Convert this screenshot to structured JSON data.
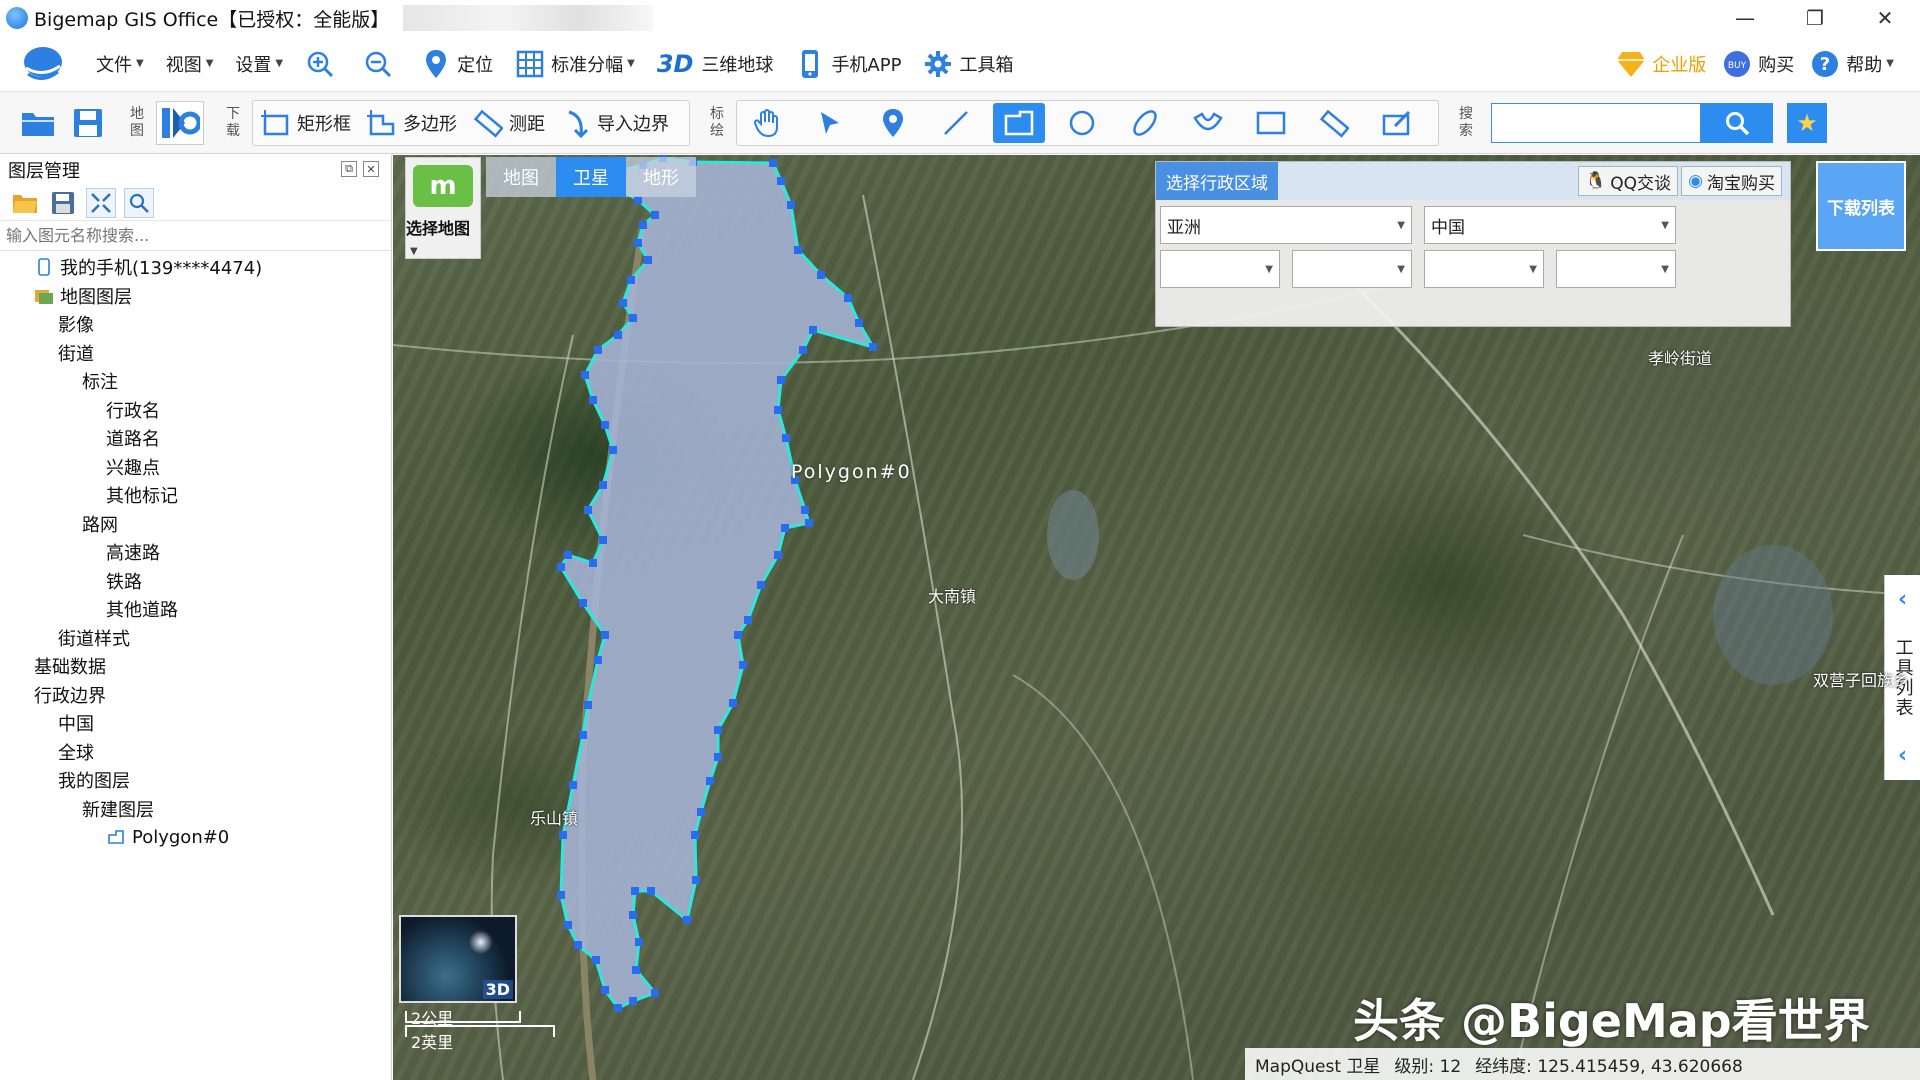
{
  "window": {
    "title": "Bigemap GIS Office【已授权：全能版】",
    "controls": [
      "—",
      "❐",
      "✕"
    ]
  },
  "menu": {
    "file": "文件",
    "view": "视图",
    "settings": "设置",
    "locate": "定位",
    "grid": "标准分幅",
    "globe_3d_prefix": "3D",
    "globe_3d": "三维地球",
    "mobile_app": "手机APP",
    "toolbox": "工具箱",
    "enterprise": "企业版",
    "buy": "购买",
    "help": "帮助"
  },
  "toolbar": {
    "map_label": "地图",
    "download_label": "下载",
    "rect": "矩形框",
    "polygon": "多边形",
    "measure": "测距",
    "import_boundary": "导入边界",
    "annotate_label": "标绘",
    "search_label": "搜索",
    "search_value": ""
  },
  "sidebar": {
    "title": "图层管理",
    "search_placeholder": "输入图元名称搜索...",
    "tree": [
      {
        "label": "我的手机(139****4474)",
        "indent": 0
      },
      {
        "label": "地图图层",
        "indent": 0
      },
      {
        "label": "影像",
        "indent": 1
      },
      {
        "label": "街道",
        "indent": 1
      },
      {
        "label": "标注",
        "indent": 2
      },
      {
        "label": "行政名",
        "indent": 3
      },
      {
        "label": "道路名",
        "indent": 3
      },
      {
        "label": "兴趣点",
        "indent": 3
      },
      {
        "label": "其他标记",
        "indent": 3
      },
      {
        "label": "路网",
        "indent": 2
      },
      {
        "label": "高速路",
        "indent": 3
      },
      {
        "label": "铁路",
        "indent": 3
      },
      {
        "label": "其他道路",
        "indent": 3
      },
      {
        "label": "街道样式",
        "indent": 1
      },
      {
        "label": "基础数据",
        "indent": 0
      },
      {
        "label": "行政边界",
        "indent": 0
      },
      {
        "label": "中国",
        "indent": 1
      },
      {
        "label": "全球",
        "indent": 1
      },
      {
        "label": "我的图层",
        "indent": 1
      },
      {
        "label": "新建图层",
        "indent": 2
      },
      {
        "label": "Polygon#0",
        "indent": 3
      }
    ]
  },
  "map": {
    "tabs": [
      "地图",
      "卫星",
      "地形"
    ],
    "active_tab": "卫星",
    "select_map": "选择地图",
    "mq_logo": "m",
    "admin_title": "选择行政区域",
    "qq_chat": "QQ交谈",
    "taobao_buy": "淘宝购买",
    "continent": "亚洲",
    "country": "中国",
    "download_list": "下载列表",
    "tool_list": "工具列表",
    "polygon_name": "Polygon#0",
    "place_labels": [
      "孝岭街道",
      "大南镇",
      "双营子回族乡",
      "乐山镇"
    ],
    "mini_map_badge": "3D",
    "scale_km": "2公里",
    "scale_mi": "2英里",
    "status_source": "MapQuest 卫星",
    "status_level": "级别:  12",
    "status_coords": "经纬度:  125.415459, 43.620668",
    "watermark": "头条 @BigeMap看世界"
  },
  "colors": {
    "accent": "#2d8cf0",
    "polygon_fill": "#a6b4d6",
    "polygon_edge": "#2ee6e0",
    "vertex": "#2a6cf0"
  }
}
